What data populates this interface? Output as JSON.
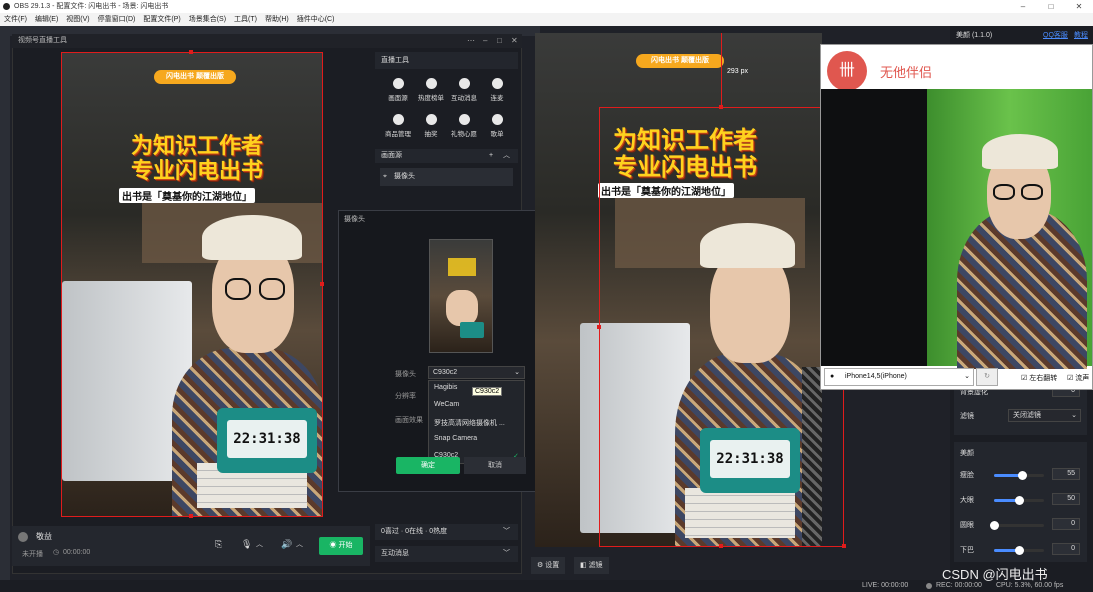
{
  "window": {
    "title": "OBS 29.1.3 - 配置文件: 闪电出书 - 场景: 闪电出书"
  },
  "menu": [
    "文件(F)",
    "编辑(E)",
    "视图(V)",
    "停靠窗口(D)",
    "配置文件(P)",
    "场景集合(S)",
    "工具(T)",
    "帮助(H)",
    "插件中心(C)"
  ],
  "panel": {
    "title": "视频号直播工具"
  },
  "overlay": {
    "banner": "闪电出书 颠覆出版",
    "title_line1": "为知识工作者",
    "title_line2": "专业闪电出书",
    "subtitle": "出书是「奠基你的江湖地位」",
    "clock_time": "22:31:38",
    "book_label": "闪电出书"
  },
  "live_tools": {
    "header": "直播工具",
    "tools": [
      "画面源",
      "热度榜单",
      "互动消息",
      "连麦",
      "商品管理",
      "抽奖",
      "礼物心愿",
      "歌单"
    ],
    "source_section": "画面源",
    "source_item": "摄像头",
    "stats": "0喜过 · 0在线 · 0热度",
    "interactions": "互动消息"
  },
  "camera_dialog": {
    "title": "摄像头",
    "camera_label": "摄像头",
    "camera_value": "C930c2",
    "resolution_label": "分辨率",
    "effect_label": "画面效果",
    "options": [
      "Hagibis",
      "WeCam",
      "罗技高清网络摄像机 ...",
      "Snap Camera",
      "C930c2"
    ],
    "tooltip": "C930c2",
    "ok": "确定",
    "cancel": "取消"
  },
  "preview2": {
    "dim_label": "293 px"
  },
  "right_panel": {
    "title": "美颜 (1.1.0)",
    "link1": "QQ客服",
    "link2": "教程",
    "filter_label": "滤镜",
    "filter_value": "关闭滤镜",
    "beauty_title": "美颜",
    "sharpen_label": "背景虚化",
    "sharpen_value": "0",
    "sliders": [
      {
        "label": "瘦脸",
        "value": "55",
        "level": 0.55
      },
      {
        "label": "大眼",
        "value": "50",
        "level": 0.5
      },
      {
        "label": "圆眼",
        "value": "0",
        "level": 0
      },
      {
        "label": "下巴",
        "value": "0",
        "level": 0.5
      }
    ]
  },
  "phone_app": {
    "brand": "无他伴侣",
    "device": "iPhone14,5(iPhone)",
    "flip_label": "左右翻转",
    "mirror_label": "流声"
  },
  "bottom": {
    "user_name": "敬益",
    "status": "未开播",
    "timer": "00:00:00",
    "go_live": "开始"
  },
  "bottom_buttons": {
    "settings": "设置",
    "filters": "滤镜"
  },
  "statusbar": {
    "live": "LIVE: 00:00:00",
    "rec": "REC: 00:00:00",
    "cpu": "CPU: 5.3%, 60.00 fps"
  },
  "watermark": "CSDN @闪电出书"
}
